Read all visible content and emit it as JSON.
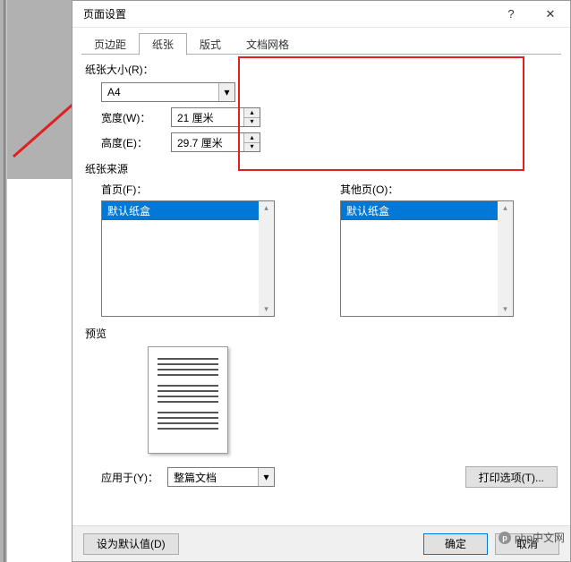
{
  "titlebar": {
    "title": "页面设置",
    "help_symbol": "?",
    "close_symbol": "✕"
  },
  "tabs": {
    "margins": "页边距",
    "paper": "纸张",
    "layout": "版式",
    "docgrid": "文档网格"
  },
  "paper_size": {
    "section_label": "纸张大小(R)：",
    "selected": "A4",
    "width_label": "宽度(W)：",
    "width_value": "21 厘米",
    "height_label": "高度(E)：",
    "height_value": "29.7 厘米"
  },
  "paper_source": {
    "section_label": "纸张来源",
    "first_page_label": "首页(F)：",
    "first_page_selected": "默认纸盒",
    "other_pages_label": "其他页(O)：",
    "other_pages_selected": "默认纸盒"
  },
  "preview": {
    "section_label": "预览"
  },
  "apply": {
    "label": "应用于(Y)：",
    "value": "整篇文档",
    "print_options": "打印选项(T)..."
  },
  "footer": {
    "set_default": "设为默认值(D)",
    "ok": "确定",
    "cancel": "取消"
  },
  "watermark": {
    "text": "php中文网"
  },
  "glyph": {
    "down": "▾",
    "up": "▴",
    "tri_down": "▾",
    "tri_up": "▴"
  }
}
